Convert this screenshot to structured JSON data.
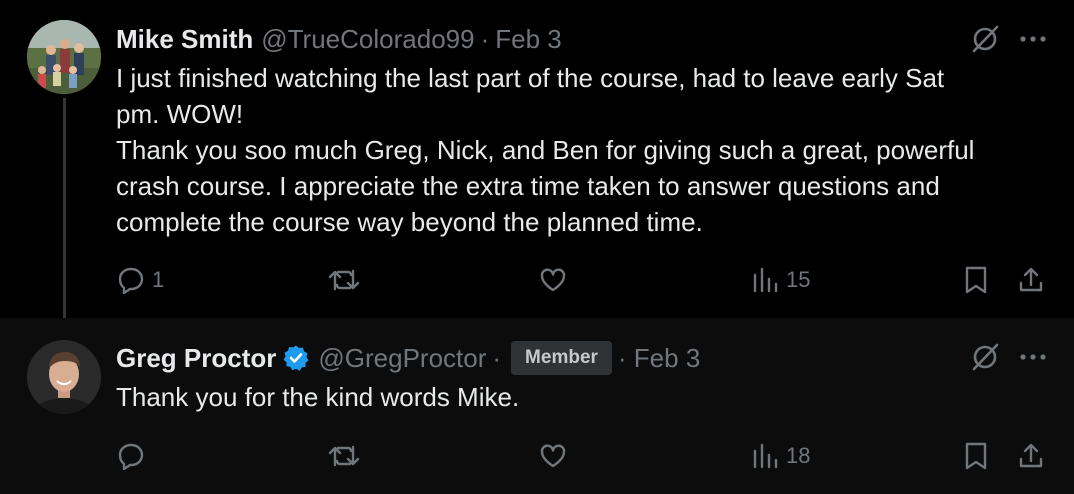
{
  "tweets": [
    {
      "author_name": "Mike Smith",
      "handle": "@TrueColorado99",
      "separator": "·",
      "date": "Feb 3",
      "text_lines": [
        "I just finished watching the last part of the course, had to leave early Sat",
        "pm. WOW!",
        "Thank you soo much Greg, Nick, and Ben for giving such a great, powerful",
        "crash course. I appreciate the extra time taken to answer questions and",
        "complete the course way beyond the planned time."
      ],
      "reply_count": "1",
      "views_count": "15",
      "icons": [
        "grok-icon",
        "more-icon",
        "reply-icon",
        "retweet-icon",
        "like-icon",
        "views-icon",
        "bookmark-icon",
        "share-icon"
      ]
    },
    {
      "author_name": "Greg Proctor",
      "verified": true,
      "handle": "@GregProctor",
      "separator": "·",
      "badge": "Member",
      "date_prefix": "· ",
      "date": "Feb 3",
      "text": "Thank you for the kind words Mike.",
      "views_count": "18",
      "icons": [
        "verified-icon",
        "grok-icon",
        "more-icon",
        "reply-icon",
        "retweet-icon",
        "like-icon",
        "views-icon",
        "bookmark-icon",
        "share-icon"
      ]
    }
  ],
  "colors": {
    "background": "#000000",
    "reply_background": "#0c0c0c",
    "text_primary": "#e7e9ea",
    "text_secondary": "#71767b",
    "verified_blue": "#1d9bf0",
    "badge_bg": "#2f3336"
  }
}
